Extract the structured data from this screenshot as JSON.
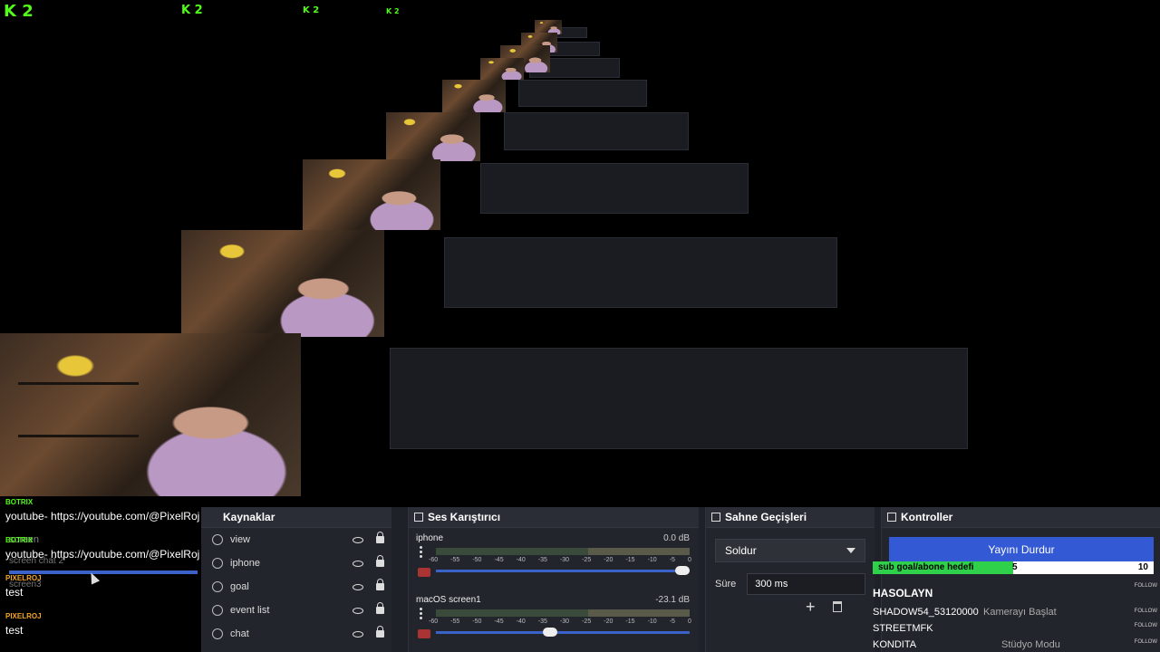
{
  "chat": [
    {
      "user": "BOTRIX",
      "user_color": "#53fc18",
      "message": "youtube- https://youtube.com/@PixelRoj"
    },
    {
      "user": "BOTRIX",
      "user_color": "#53fc18",
      "message": "youtube- https://youtube.com/@PixelRoj"
    },
    {
      "user": "PIXELROJ",
      "user_color": "#f5a623",
      "message": "test"
    },
    {
      "user": "PIXELROJ",
      "user_color": "#f5a623",
      "message": "test"
    }
  ],
  "ghost_scenes": [
    "screen",
    "screen chat 2",
    "screen3"
  ],
  "kick_badge": "2",
  "sources": {
    "title": "Kaynaklar",
    "items": [
      "view",
      "iphone",
      "goal",
      "event list",
      "chat"
    ]
  },
  "mixer": {
    "title": "Ses Karıştırıcı",
    "channels": [
      {
        "name": "iphone",
        "db": "0.0 dB",
        "level": 1.0
      },
      {
        "name": "macOS screen1",
        "db": "-23.1 dB",
        "level": 0.45
      }
    ],
    "ticks": [
      "-60",
      "-55",
      "-50",
      "-45",
      "-40",
      "-35",
      "-30",
      "-25",
      "-20",
      "-15",
      "-10",
      "-5",
      "0"
    ]
  },
  "transitions": {
    "title": "Sahne Geçişleri",
    "selected": "Soldur",
    "duration_label": "Süre",
    "duration_value": "300 ms"
  },
  "controls": {
    "title": "Kontroller",
    "stop_stream": "Yayını Durdur",
    "goal_label": "sub goal/abone hedefi",
    "goal_current": "5",
    "goal_target": "10",
    "goal_fraction": 0.5,
    "follow_label": "FOLLOW",
    "alerts": [
      "HASOLAYN",
      "SHADOW54_53120000",
      "STREETMFK",
      "KONDITA"
    ],
    "side_labels": [
      "Kamerayı Başlat",
      "Stüdyo Modu"
    ]
  },
  "colors": {
    "accent": "#3459d4",
    "kick_green": "#53fc18",
    "goal_green": "#2fd14a"
  }
}
